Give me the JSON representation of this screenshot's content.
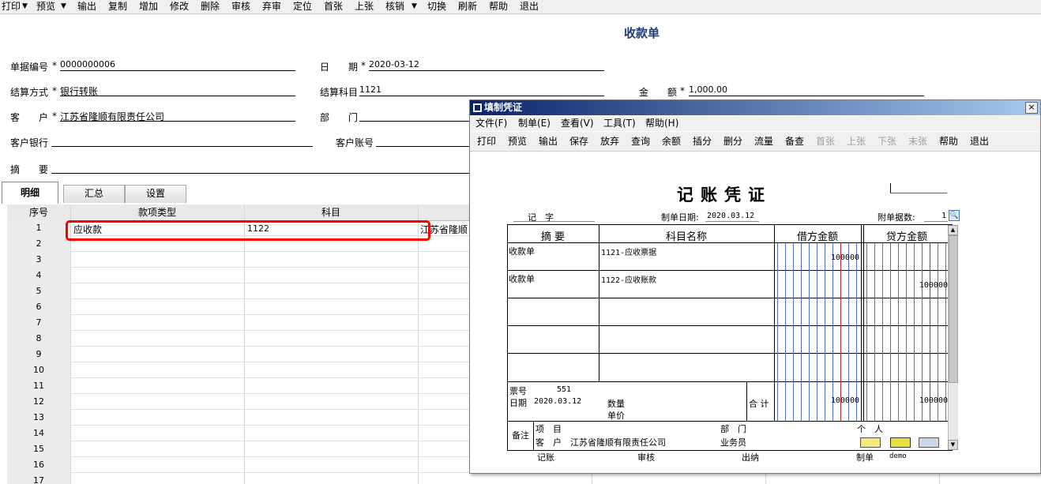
{
  "toolbar": {
    "items": [
      "打印",
      "预览",
      "输出",
      "复制",
      "增加",
      "修改",
      "删除",
      "审核",
      "弃审",
      "定位",
      "首张",
      "上张",
      "核销",
      "切换",
      "刷新",
      "帮助",
      "退出"
    ]
  },
  "form": {
    "title": "收款单",
    "doc_no_label": "单据编号",
    "doc_no": "0000000006",
    "date_label1": "日",
    "date_label2": "期",
    "date": "2020-03-12",
    "settle_method_label": "结算方式",
    "settle_method": "银行转账",
    "settle_account_label": "结算科目",
    "settle_account": "1121",
    "amount_label1": "金",
    "amount_label2": "额",
    "amount": "1,000.00",
    "customer_label1": "客",
    "customer_label2": "户",
    "customer": "江苏省隆顺有限责任公司",
    "dept_label1": "部",
    "dept_label2": "门",
    "cust_bank_label": "客户银行",
    "cust_account_label": "客户账号",
    "summary_label1": "摘",
    "summary_label2": "要",
    "required_mark": "*"
  },
  "tabs": [
    "明细",
    "汇总",
    "设置"
  ],
  "grid": {
    "columns": [
      "序号",
      "款项类型",
      "科目"
    ],
    "row_numbers": [
      "1",
      "2",
      "3",
      "4",
      "5",
      "6",
      "7",
      "8",
      "9",
      "10",
      "11",
      "12",
      "13",
      "14",
      "15",
      "16",
      "17"
    ],
    "row1": {
      "type": "应收款",
      "subject": "1122",
      "customer_partial": "江苏省隆顺"
    }
  },
  "voucher_window": {
    "title": "填制凭证",
    "close": "×",
    "menu": [
      "文件(F)",
      "制单(E)",
      "查看(V)",
      "工具(T)",
      "帮助(H)"
    ],
    "toolbar": [
      "打印",
      "预览",
      "输出",
      "保存",
      "放弃",
      "查询",
      "余额",
      "插分",
      "删分",
      "流量",
      "备查",
      "首张",
      "上张",
      "下张",
      "末张",
      "帮助",
      "退出"
    ],
    "toolbar_disabled": [
      "首张",
      "上张",
      "下张",
      "末张"
    ],
    "heading": "记账凭证",
    "voucher_type_label": "记　字",
    "date_label": "制单日期:",
    "date": "2020.03.12",
    "attach_label": "附单据数:",
    "attach_count": "1",
    "col_summary": "摘 要",
    "col_subject": "科目名称",
    "col_debit": "借方金额",
    "col_credit": "贷方金额",
    "entries": [
      {
        "summary": "收款单",
        "subject": "1121-应收票据",
        "debit": "100000",
        "credit": ""
      },
      {
        "summary": "收款单",
        "subject": "1122-应收账款",
        "debit": "",
        "credit": "100000"
      }
    ],
    "ticket_label": "票号",
    "ticket_no": "551",
    "date2_label": "日期",
    "date2": "2020.03.12",
    "qty_label": "数量",
    "unit_price_label": "单价",
    "total_label": "合 计",
    "total_debit": "100000",
    "total_credit": "100000",
    "remark_label": "备注",
    "project_label": "项　目",
    "dept_label": "部　门",
    "person_label": "个　人",
    "customer_label": "客　户",
    "customer": "江苏省隆顺有限责任公司",
    "salesman_label": "业务员",
    "bookkeeper_label": "记账",
    "auditor_label": "审核",
    "cashier_label": "出纳",
    "maker_label": "制单",
    "maker": "demo"
  },
  "colors": {
    "highlight": "#ff0000",
    "title_blue": "#1f3c7a",
    "titlebar": "#0a246a"
  }
}
